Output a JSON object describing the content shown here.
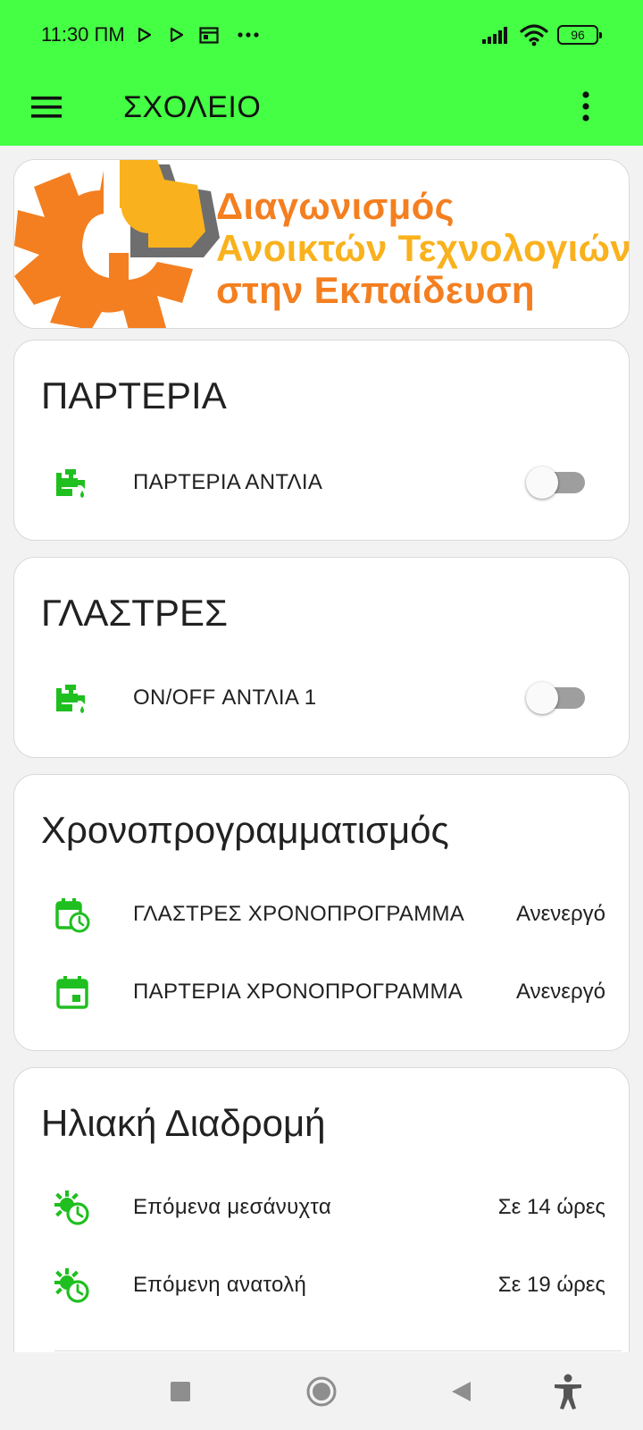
{
  "status_bar": {
    "time": "11:30 ΠΜ",
    "notification_icons": [
      "play-store-icon",
      "play-store-icon",
      "calendar-icon",
      "more-dots-icon"
    ],
    "battery_level": "96"
  },
  "app_bar": {
    "title": "ΣΧΟΛΕΙΟ",
    "accent_color": "#44ff44"
  },
  "banner": {
    "lines": [
      "Διαγωνισμός",
      "Ανοικτών Τεχνολογιών",
      "στην Εκπαίδευση"
    ],
    "colors": {
      "orange": "#f47f20",
      "yellow": "#f9b21d"
    }
  },
  "cards": {
    "parteria": {
      "title": "ΠΑΡΤΕΡΙΑ",
      "switch_label": "ΠΑΡΤΕΡΙΑ ΑΝΤΛΙΑ",
      "switch_on": false
    },
    "glastres": {
      "title": "ΓΛΑΣΤΡΕΣ",
      "switch_label": "ON/OFF ΑΝΤΛΙΑ 1",
      "switch_on": false
    },
    "schedule": {
      "title": "Χρονοπρογραμματισμός",
      "rows": [
        {
          "label": "ΓΛΑΣΤΡΕΣ ΧΡΟΝΟΠΡΟΓΡΑΜΜΑ",
          "value": "Ανενεργό",
          "icon": "calendar-clock-icon"
        },
        {
          "label": "ΠΑΡΤΕΡΙΑ ΧΡΟΝΟΠΡΟΓΡΑΜΜΑ",
          "value": "Ανενεργό",
          "icon": "calendar-icon"
        }
      ]
    },
    "sun": {
      "title": "Ηλιακή Διαδρομή",
      "rows": [
        {
          "label": "Επόμενα μεσάνυχτα",
          "value": "Σε 14 ώρες",
          "icon": "sun-clock-icon"
        },
        {
          "label": "Επόμενη ανατολή",
          "value": "Σε 19 ώρες",
          "icon": "sun-clock-icon"
        }
      ]
    }
  },
  "icon_color": "#1fbf1f",
  "nav_bar": {
    "buttons": [
      "recents-button",
      "home-button",
      "back-button",
      "accessibility-button"
    ]
  }
}
